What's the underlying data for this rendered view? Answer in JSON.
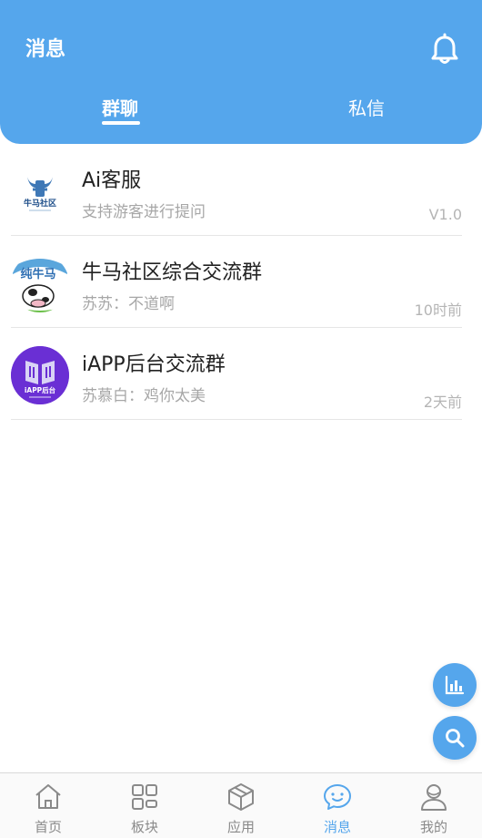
{
  "header": {
    "title": "消息",
    "notification_icon": "bell-icon",
    "tabs": [
      {
        "label": "群聊",
        "active": true
      },
      {
        "label": "私信",
        "active": false
      }
    ]
  },
  "chats": [
    {
      "name": "Ai客服",
      "preview": "支持游客进行提问",
      "time": "V1.0",
      "avatar_icon": "niuma-community-logo",
      "avatar_text": "牛马社区"
    },
    {
      "name": "牛马社区综合交流群",
      "preview": "苏苏：不道啊",
      "time": "10时前",
      "avatar_icon": "cow-cartoon-avatar",
      "avatar_text": "纯牛马"
    },
    {
      "name": "iAPP后台交流群",
      "preview": "苏慕白：鸡你太美",
      "time": "2天前",
      "avatar_icon": "iapp-logo",
      "avatar_text": "iAPP后台"
    }
  ],
  "floating_buttons": [
    {
      "icon": "bar-chart-icon"
    },
    {
      "icon": "search-icon"
    }
  ],
  "tabbar": {
    "items": [
      {
        "label": "首页",
        "icon": "home-icon",
        "active": false
      },
      {
        "label": "板块",
        "icon": "grid-icon",
        "active": false
      },
      {
        "label": "应用",
        "icon": "cube-icon",
        "active": false
      },
      {
        "label": "消息",
        "icon": "chat-bubble-icon",
        "active": true
      },
      {
        "label": "我的",
        "icon": "user-icon",
        "active": false
      }
    ]
  },
  "colors": {
    "primary": "#55a6ec",
    "text_primary": "#222222",
    "text_secondary": "#a7a7a7",
    "tab_inactive": "#8a8a8a"
  }
}
